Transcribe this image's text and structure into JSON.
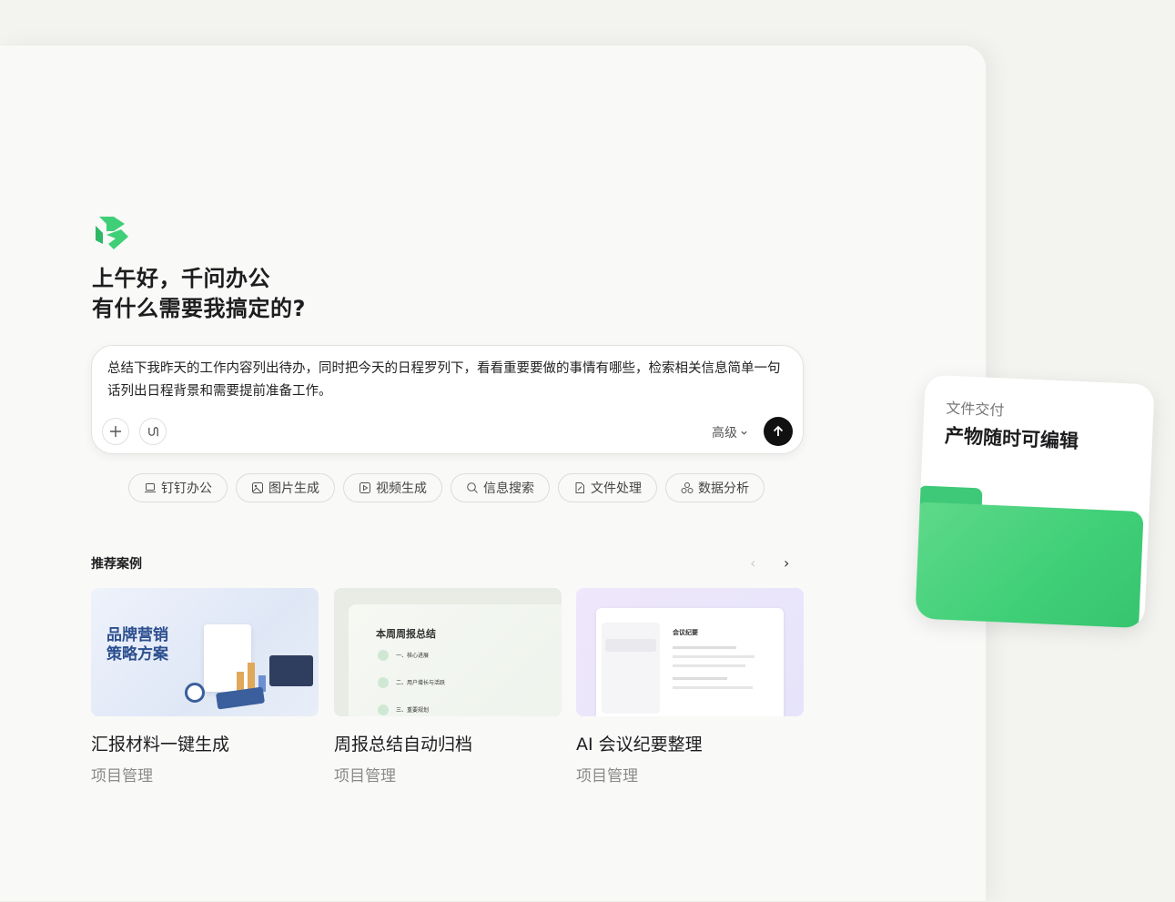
{
  "greeting": {
    "line1": "上午好，千问办公",
    "line2": "有什么需要我搞定的?"
  },
  "input": {
    "text": "总结下我昨天的工作内容列出待办，同时把今天的日程罗列下，看看重要要做的事情有哪些，检索相关信息简单一句话列出日程背景和需要提前准备工作。",
    "advanced_label": "高级"
  },
  "chips": [
    {
      "label": "钉钉办公",
      "icon": "laptop-icon"
    },
    {
      "label": "图片生成",
      "icon": "image-icon"
    },
    {
      "label": "视频生成",
      "icon": "video-icon"
    },
    {
      "label": "信息搜索",
      "icon": "search-icon"
    },
    {
      "label": "文件处理",
      "icon": "file-icon"
    },
    {
      "label": "数据分析",
      "icon": "data-icon"
    }
  ],
  "recommend": {
    "title": "推荐案例",
    "cards": [
      {
        "title": "汇报材料一键生成",
        "category": "项目管理",
        "thumb_text": "品牌营销\n策略方案"
      },
      {
        "title": "周报总结自动归档",
        "category": "项目管理",
        "thumb_text": "本周周报总结",
        "items": [
          "一、核心进展",
          "二、用户增长与活跃",
          "三、重要规划"
        ]
      },
      {
        "title": "AI 会议纪要整理",
        "category": "项目管理",
        "thumb_text": "会议纪要"
      }
    ]
  },
  "float_card": {
    "subtitle": "文件交付",
    "title": "产物随时可编辑"
  },
  "colors": {
    "brand_green": "#3fcf77",
    "send_button": "#111111"
  }
}
